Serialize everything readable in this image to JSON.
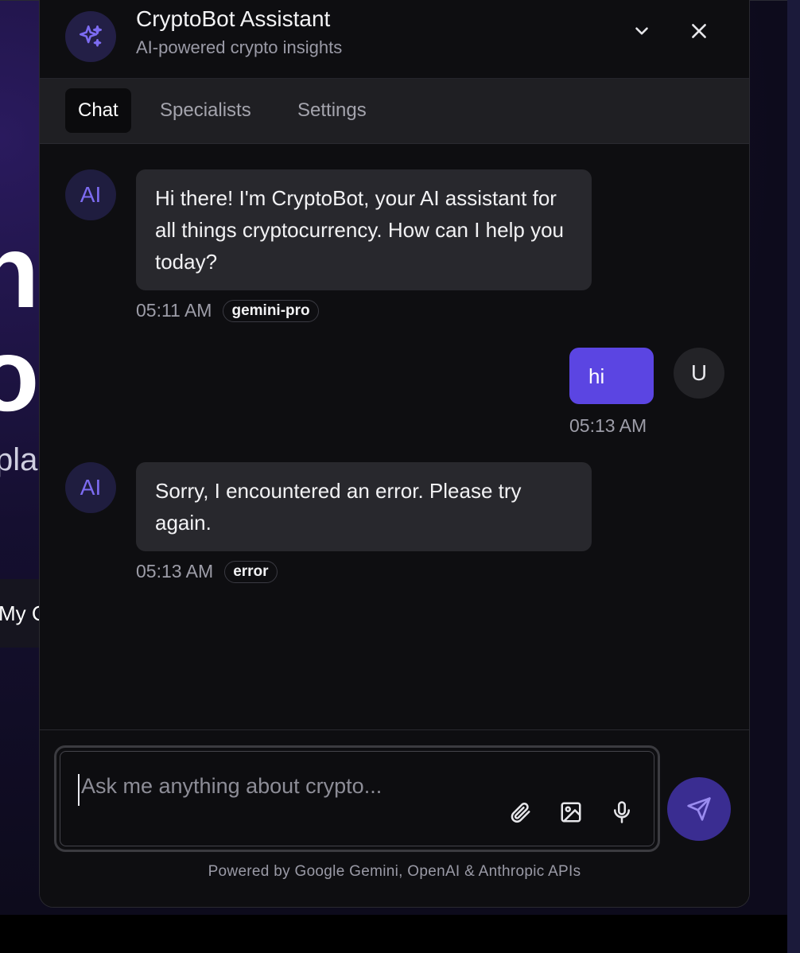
{
  "background": {
    "hero_line1": "n",
    "hero_line2": "ot",
    "subtitle_fragment": "pla",
    "button_fragment": "My C"
  },
  "header": {
    "title": "CryptoBot Assistant",
    "subtitle": "AI-powered crypto insights",
    "logo_icon": "sparkles-icon",
    "minimize_icon": "chevron-down-icon",
    "close_icon": "close-icon"
  },
  "tabs": [
    {
      "label": "Chat",
      "active": true
    },
    {
      "label": "Specialists",
      "active": false
    },
    {
      "label": "Settings",
      "active": false
    }
  ],
  "messages": [
    {
      "role": "ai",
      "avatar": "AI",
      "text": "Hi there! I'm CryptoBot, your AI assistant for all things cryptocurrency. How can I help you today?",
      "time": "05:11 AM",
      "badge": "gemini-pro"
    },
    {
      "role": "user",
      "avatar": "U",
      "text": "hi",
      "time": "05:13 AM"
    },
    {
      "role": "ai",
      "avatar": "AI",
      "text": "Sorry, I encountered an error. Please try again.",
      "time": "05:13 AM",
      "badge": "error"
    }
  ],
  "composer": {
    "placeholder": "Ask me anything about crypto...",
    "value": "",
    "tools": [
      "paperclip-icon",
      "image-icon",
      "microphone-icon"
    ],
    "send_icon": "send-icon"
  },
  "footer": {
    "text": "Powered by Google Gemini, OpenAI & Anthropic APIs"
  },
  "colors": {
    "accent": "#5b45e2",
    "panel_bg": "#0e0e11",
    "bubble_ai": "#28282d",
    "tab_bar": "#1f1f23"
  }
}
